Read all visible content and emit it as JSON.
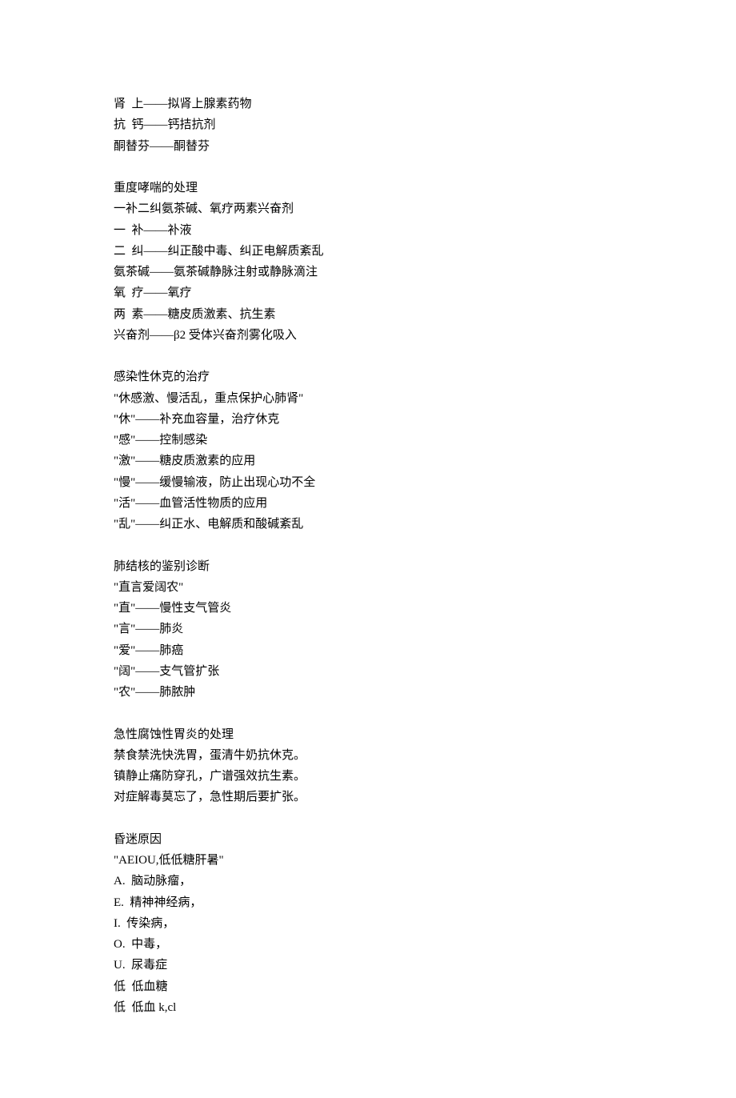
{
  "blocks": [
    {
      "lines": [
        "肾  上——拟肾上腺素药物",
        "抗  钙——钙拮抗剂",
        "酮替芬——酮替芬"
      ]
    },
    {
      "lines": [
        "重度哮喘的处理",
        "一补二纠氨茶碱、氧疗两素兴奋剂",
        "一  补——补液",
        "二  纠——纠正酸中毒、纠正电解质紊乱",
        "氨茶碱——氨茶碱静脉注射或静脉滴注",
        "氧  疗——氧疗",
        "两  素——糖皮质激素、抗生素",
        "兴奋剂——β2 受体兴奋剂雾化吸入"
      ]
    },
    {
      "lines": [
        "感染性休克的治疗",
        "\"休感激、慢活乱，重点保护心肺肾\"",
        "\"休\"——补充血容量，治疗休克",
        "\"感\"——控制感染",
        "\"激\"——糖皮质激素的应用",
        "\"慢\"——缓慢输液，防止出现心功不全",
        "\"活\"——血管活性物质的应用",
        "\"乱\"——纠正水、电解质和酸碱紊乱"
      ]
    },
    {
      "lines": [
        "肺结核的鉴别诊断",
        "\"直言爱阔农\"",
        "\"直\"——慢性支气管炎",
        "\"言\"——肺炎",
        "\"爱\"——肺癌",
        "\"阔\"——支气管扩张",
        "\"农\"——肺脓肿"
      ]
    },
    {
      "lines": [
        "急性腐蚀性胃炎的处理",
        "禁食禁洗快洗胃，蛋清牛奶抗休克。",
        "镇静止痛防穿孔，广谱强效抗生素。",
        "对症解毒莫忘了，急性期后要扩张。"
      ]
    },
    {
      "lines": [
        "昏迷原因",
        "\"AEIOU,低低糖肝暑\"",
        "A.  脑动脉瘤，",
        "E.  精神神经病，",
        "I.  传染病，",
        "O.  中毒，",
        "U.  尿毒症",
        "低  低血糖",
        "低  低血 k,cl"
      ]
    }
  ]
}
